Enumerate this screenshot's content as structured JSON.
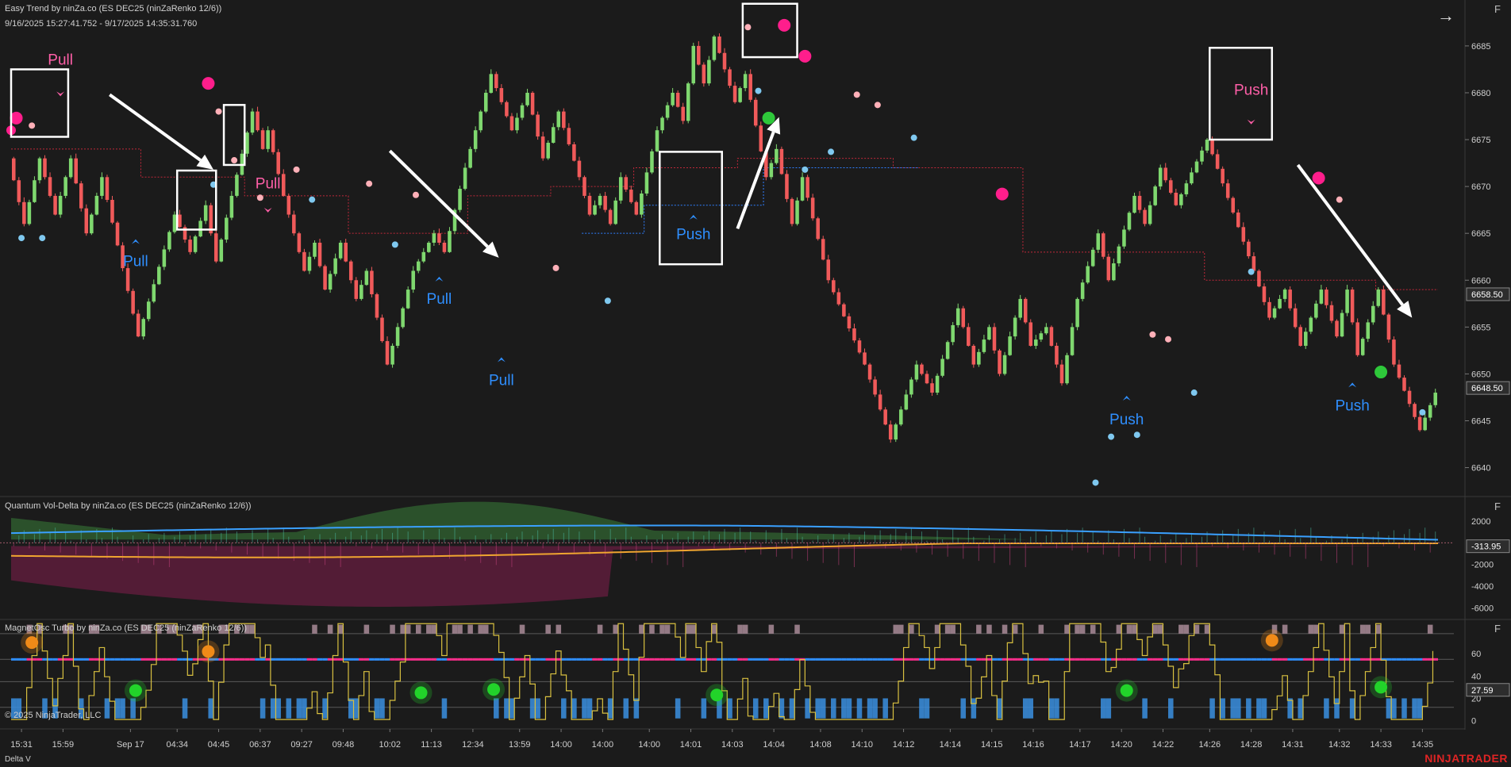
{
  "colors": {
    "background": "#1b1b1b",
    "up": "#7fd86f",
    "down": "#f05a5a",
    "label_pull_top": "#ff5fa8",
    "label_blue": "#2f8fff",
    "resistance": "#c0283a",
    "support": "#2f7fff",
    "arrow": "#ffffff",
    "box": "#ffffff",
    "magenta": "#ff1e8c",
    "pink": "#ffb0b8",
    "lightblue": "#7fc8ef",
    "green": "#2ec83a"
  },
  "panes": {
    "main": {
      "title": "Easy Trend by ninZa.co (ES DEC25 (ninZaRenko 12/6))",
      "date_range": "9/16/2025 15:27:41.752 - 9/17/2025 14:35:31.760",
      "f_button": "F",
      "nav_icon": "arrow-right-icon"
    },
    "volume": {
      "title": "Quantum Vol-Delta by ninZa.co (ES DEC25 (ninZaRenko 12/6))",
      "f_button": "F",
      "last_value": "-313.95"
    },
    "osc": {
      "title": "MagnetOsc Turbo by ninZa.co (ES DEC25 (ninZaRenko 12/6))",
      "f_button": "F",
      "last_value": "27.59"
    }
  },
  "copyright": "© 2025 NinjaTrader, LLC",
  "brand": "NINJATRADER",
  "bottom_label": "Delta V",
  "chart_data": [
    {
      "type": "candlestick",
      "pane": "main",
      "y_ticks": [
        6640,
        6645,
        6650,
        6655,
        6660,
        6665,
        6670,
        6675,
        6680,
        6685
      ],
      "ylim": [
        6637.0,
        6689.9
      ],
      "price_labels": [
        {
          "value": 6658.5,
          "text": "6658.50"
        },
        {
          "value": 6648.5,
          "text": "6648.50"
        }
      ],
      "brick_size": 1,
      "swings": [
        [
          0,
          6673
        ],
        [
          3,
          6666
        ],
        [
          6,
          6673
        ],
        [
          9,
          6667
        ],
        [
          12,
          6673
        ],
        [
          15,
          6665
        ],
        [
          18,
          6671
        ],
        [
          25,
          6654
        ],
        [
          32,
          6667
        ],
        [
          35,
          6663
        ],
        [
          38,
          6668
        ],
        [
          40,
          6662
        ],
        [
          43,
          6669
        ],
        [
          47,
          6678
        ],
        [
          49,
          6674
        ],
        [
          50,
          6676
        ],
        [
          53,
          6669
        ],
        [
          57,
          6661
        ],
        [
          59,
          6664
        ],
        [
          61,
          6659
        ],
        [
          64,
          6664
        ],
        [
          67,
          6658
        ],
        [
          69,
          6661
        ],
        [
          73,
          6651
        ],
        [
          78,
          6661
        ],
        [
          82,
          6665
        ],
        [
          84,
          6663
        ],
        [
          88,
          6672
        ],
        [
          93,
          6682
        ],
        [
          97,
          6676
        ],
        [
          100,
          6680
        ],
        [
          103,
          6673
        ],
        [
          106,
          6678
        ],
        [
          110,
          6671
        ],
        [
          112,
          6667
        ],
        [
          114,
          6669
        ],
        [
          116,
          6666
        ],
        [
          118,
          6671
        ],
        [
          121,
          6667
        ],
        [
          125,
          6676
        ],
        [
          128,
          6680
        ],
        [
          130,
          6677
        ],
        [
          132,
          6685
        ],
        [
          134,
          6681
        ],
        [
          136,
          6686
        ],
        [
          140,
          6679
        ],
        [
          142,
          6682
        ],
        [
          146,
          6671
        ],
        [
          148,
          6674
        ],
        [
          151,
          6666
        ],
        [
          153,
          6671
        ],
        [
          158,
          6660
        ],
        [
          165,
          6651
        ],
        [
          170,
          6643
        ],
        [
          175,
          6651
        ],
        [
          178,
          6648
        ],
        [
          183,
          6657
        ],
        [
          186,
          6651
        ],
        [
          189,
          6655
        ],
        [
          191,
          6650
        ],
        [
          195,
          6658
        ],
        [
          197,
          6653
        ],
        [
          200,
          6655
        ],
        [
          203,
          6649
        ],
        [
          206,
          6658
        ],
        [
          210,
          6665
        ],
        [
          212,
          6660
        ],
        [
          217,
          6669
        ],
        [
          219,
          6666
        ],
        [
          222,
          6672
        ],
        [
          225,
          6668
        ],
        [
          231,
          6675
        ],
        [
          240,
          6661
        ],
        [
          243,
          6656
        ],
        [
          246,
          6659
        ],
        [
          249,
          6653
        ],
        [
          253,
          6659
        ],
        [
          256,
          6654
        ],
        [
          258,
          6659
        ],
        [
          260,
          6652
        ],
        [
          264,
          6659
        ],
        [
          267,
          6651
        ],
        [
          272,
          6644
        ],
        [
          275,
          6648
        ]
      ],
      "resistance_line": [
        [
          0,
          6674
        ],
        [
          25,
          6671
        ],
        [
          45,
          6669
        ],
        [
          65,
          6665
        ],
        [
          88,
          6669
        ],
        [
          104,
          6670
        ],
        [
          120,
          6672
        ],
        [
          140,
          6673
        ],
        [
          170,
          6672
        ],
        [
          195,
          6663
        ],
        [
          230,
          6660
        ],
        [
          263,
          6659
        ],
        [
          275,
          6659
        ]
      ],
      "support_line": [
        [
          110,
          6665
        ],
        [
          122,
          6668
        ],
        [
          145,
          6672
        ],
        [
          175,
          6672
        ]
      ],
      "labels": [
        {
          "text": "Pull",
          "bar": 9.5,
          "price": 6683,
          "color": "pink"
        },
        {
          "text": "Pull",
          "bar": 49.5,
          "price": 6669.8,
          "color": "pink"
        },
        {
          "text": "Pull",
          "bar": 24,
          "price": 6661.5,
          "color": "blue"
        },
        {
          "text": "Pull",
          "bar": 82.5,
          "price": 6657.5,
          "color": "blue"
        },
        {
          "text": "Pull",
          "bar": 94.5,
          "price": 6648.8,
          "color": "blue"
        },
        {
          "text": "Push",
          "bar": 131.5,
          "price": 6664.4,
          "color": "blue"
        },
        {
          "text": "Push",
          "bar": 239,
          "price": 6679.8,
          "color": "pink"
        },
        {
          "text": "Push",
          "bar": 215,
          "price": 6644.6,
          "color": "blue"
        },
        {
          "text": "Push",
          "bar": 258.5,
          "price": 6646.1,
          "color": "blue"
        }
      ]
    },
    {
      "type": "area",
      "pane": "volume",
      "y_ticks": [
        -6000,
        -4000,
        -2000,
        2000
      ],
      "ylim": [
        -7000,
        4200
      ],
      "series": []
    },
    {
      "type": "line",
      "pane": "osc",
      "y_ticks": [
        0,
        20,
        40,
        60
      ],
      "ylim": [
        -6,
        90
      ],
      "hlines": [
        55,
        35
      ],
      "series": []
    }
  ],
  "x_axis": {
    "ticks": [
      {
        "bar": 2,
        "label": "15:31"
      },
      {
        "bar": 10,
        "label": "15:59"
      },
      {
        "bar": 23,
        "label": "Sep 17"
      },
      {
        "bar": 32,
        "label": "04:34"
      },
      {
        "bar": 40,
        "label": "04:45"
      },
      {
        "bar": 48,
        "label": "06:37"
      },
      {
        "bar": 56,
        "label": "09:27"
      },
      {
        "bar": 64,
        "label": "09:48"
      },
      {
        "bar": 73,
        "label": "10:02"
      },
      {
        "bar": 81,
        "label": "11:13"
      },
      {
        "bar": 89,
        "label": "12:34"
      },
      {
        "bar": 98,
        "label": "13:59"
      },
      {
        "bar": 106,
        "label": "14:00"
      },
      {
        "bar": 114,
        "label": "14:00"
      },
      {
        "bar": 123,
        "label": "14:00"
      },
      {
        "bar": 131,
        "label": "14:01"
      },
      {
        "bar": 139,
        "label": "14:03"
      },
      {
        "bar": 147,
        "label": "14:04"
      },
      {
        "bar": 156,
        "label": "14:08"
      },
      {
        "bar": 164,
        "label": "14:10"
      },
      {
        "bar": 172,
        "label": "14:12"
      },
      {
        "bar": 181,
        "label": "14:14"
      },
      {
        "bar": 189,
        "label": "14:15"
      },
      {
        "bar": 197,
        "label": "14:16"
      },
      {
        "bar": 206,
        "label": "14:17"
      },
      {
        "bar": 214,
        "label": "14:20"
      },
      {
        "bar": 222,
        "label": "14:22"
      },
      {
        "bar": 231,
        "label": "14:26"
      },
      {
        "bar": 239,
        "label": "14:28"
      },
      {
        "bar": 247,
        "label": "14:31"
      },
      {
        "bar": 256,
        "label": "14:32"
      },
      {
        "bar": 264,
        "label": "14:33"
      },
      {
        "bar": 272,
        "label": "14:35"
      }
    ]
  }
}
